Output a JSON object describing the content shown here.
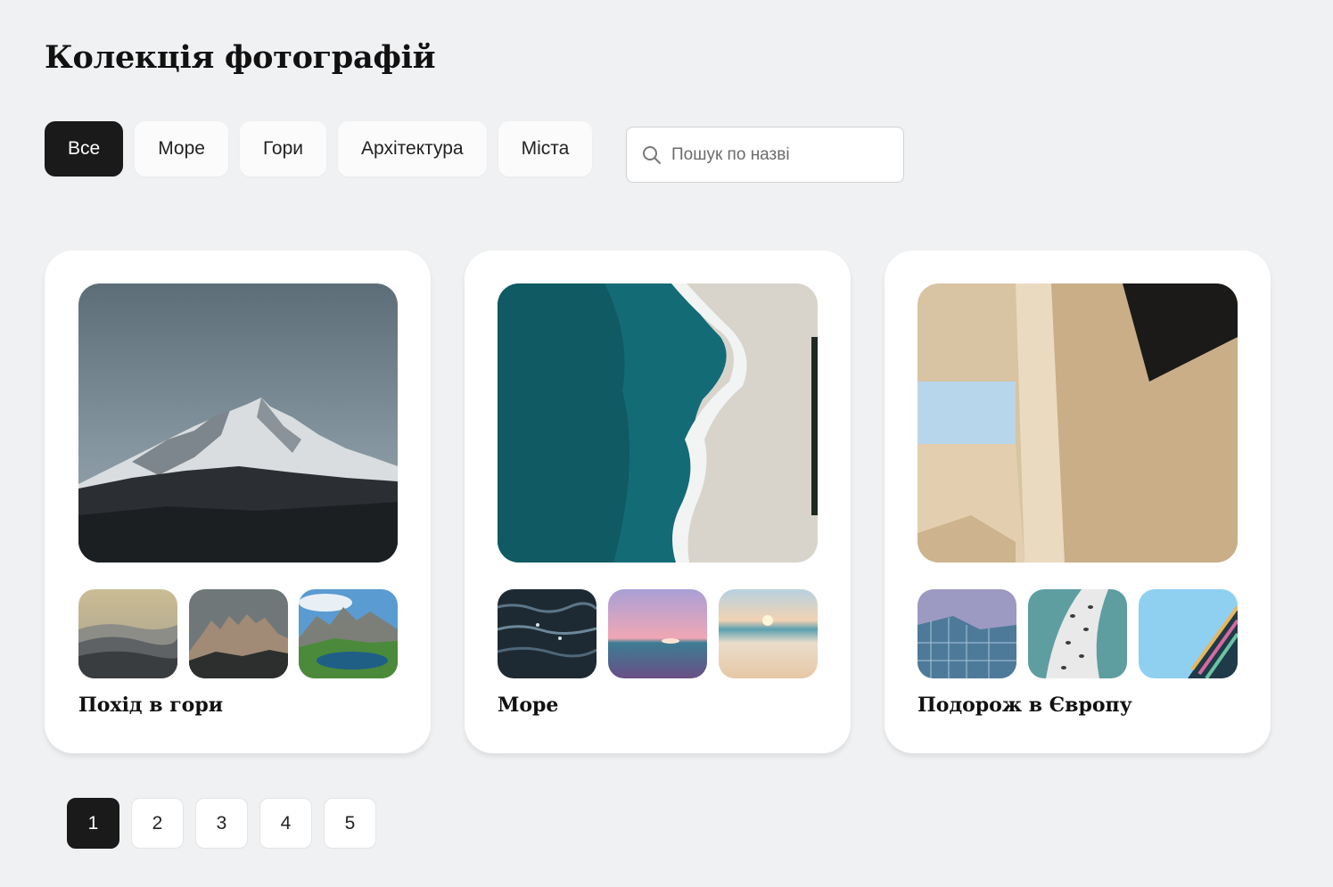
{
  "page": {
    "title": "Колекція фотографій"
  },
  "filters": [
    {
      "label": "Все",
      "active": true
    },
    {
      "label": "Море",
      "active": false
    },
    {
      "label": "Гори",
      "active": false
    },
    {
      "label": "Архітектура",
      "active": false
    },
    {
      "label": "Міста",
      "active": false
    }
  ],
  "search": {
    "placeholder": "Пошук по назві",
    "value": "",
    "icon": "search-icon"
  },
  "albums": [
    {
      "title": "Похід в гори",
      "cover": "snowy-mountain-photo",
      "thumbnails": [
        "misty-hills-photo",
        "rocky-peaks-photo",
        "alpine-lake-photo"
      ]
    },
    {
      "title": "Море",
      "cover": "aerial-beach-waves-photo",
      "thumbnails": [
        "dark-ocean-water-photo",
        "pink-sunset-sea-photo",
        "sandy-beach-sunrise-photo"
      ]
    },
    {
      "title": "Подорож в Європу",
      "cover": "wooden-architecture-photo",
      "thumbnails": [
        "glass-building-photo",
        "curved-white-building-photo",
        "colorful-facade-photo"
      ]
    }
  ],
  "pagination": {
    "pages": [
      "1",
      "2",
      "3",
      "4",
      "5"
    ],
    "current": "1"
  },
  "colors": {
    "background": "#f0f1f3",
    "active": "#1a1a1a",
    "card": "#ffffff"
  }
}
